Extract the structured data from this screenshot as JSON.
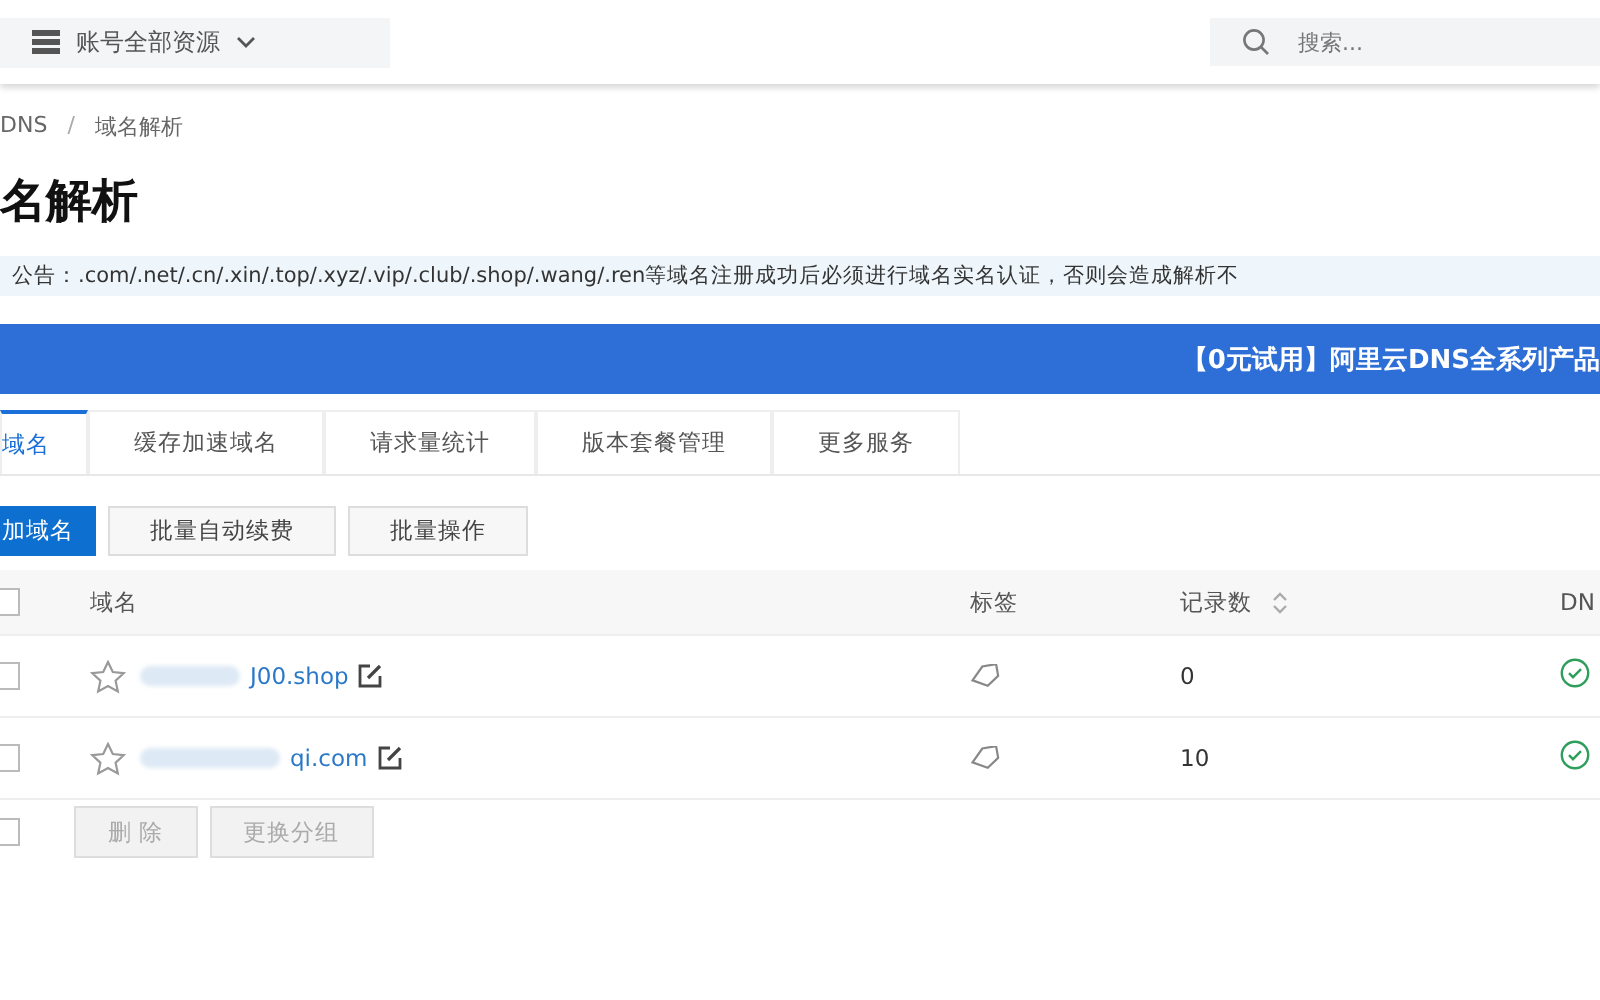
{
  "topbar": {
    "resource_selector": "账号全部资源",
    "search": {
      "placeholder": "搜索..."
    }
  },
  "breadcrumb": {
    "items": [
      "DNS",
      "域名解析"
    ],
    "separator": "/"
  },
  "title": "名解析",
  "notice": "公告：.com/.net/.cn/.xin/.top/.xyz/.vip/.club/.shop/.wang/.ren等域名注册成功后必须进行域名实名认证，否则会造成解析不",
  "banner": "【0元试用】阿里云DNS全系列产品",
  "tabs": [
    {
      "label": "域名",
      "selected": true
    },
    {
      "label": "缓存加速域名",
      "selected": false
    },
    {
      "label": "请求量统计",
      "selected": false
    },
    {
      "label": "版本套餐管理",
      "selected": false
    },
    {
      "label": "更多服务",
      "selected": false
    }
  ],
  "actions": [
    {
      "label": "加域名",
      "primary": true
    },
    {
      "label": "批量自动续费",
      "primary": false
    },
    {
      "label": "批量操作",
      "primary": false
    }
  ],
  "table": {
    "columns": [
      "域名",
      "标签",
      "记录数",
      "DN"
    ],
    "select_all_checked": false,
    "rows": [
      {
        "checked": false,
        "starred": false,
        "domain": "J00.shop",
        "records": "0"
      },
      {
        "checked": false,
        "starred": false,
        "domain": "qi.com",
        "records": "10"
      }
    ]
  },
  "footer": {
    "checked": false,
    "buttons": [
      {
        "label": "删 除",
        "disabled": true
      },
      {
        "label": "更换分组",
        "disabled": true
      }
    ]
  }
}
